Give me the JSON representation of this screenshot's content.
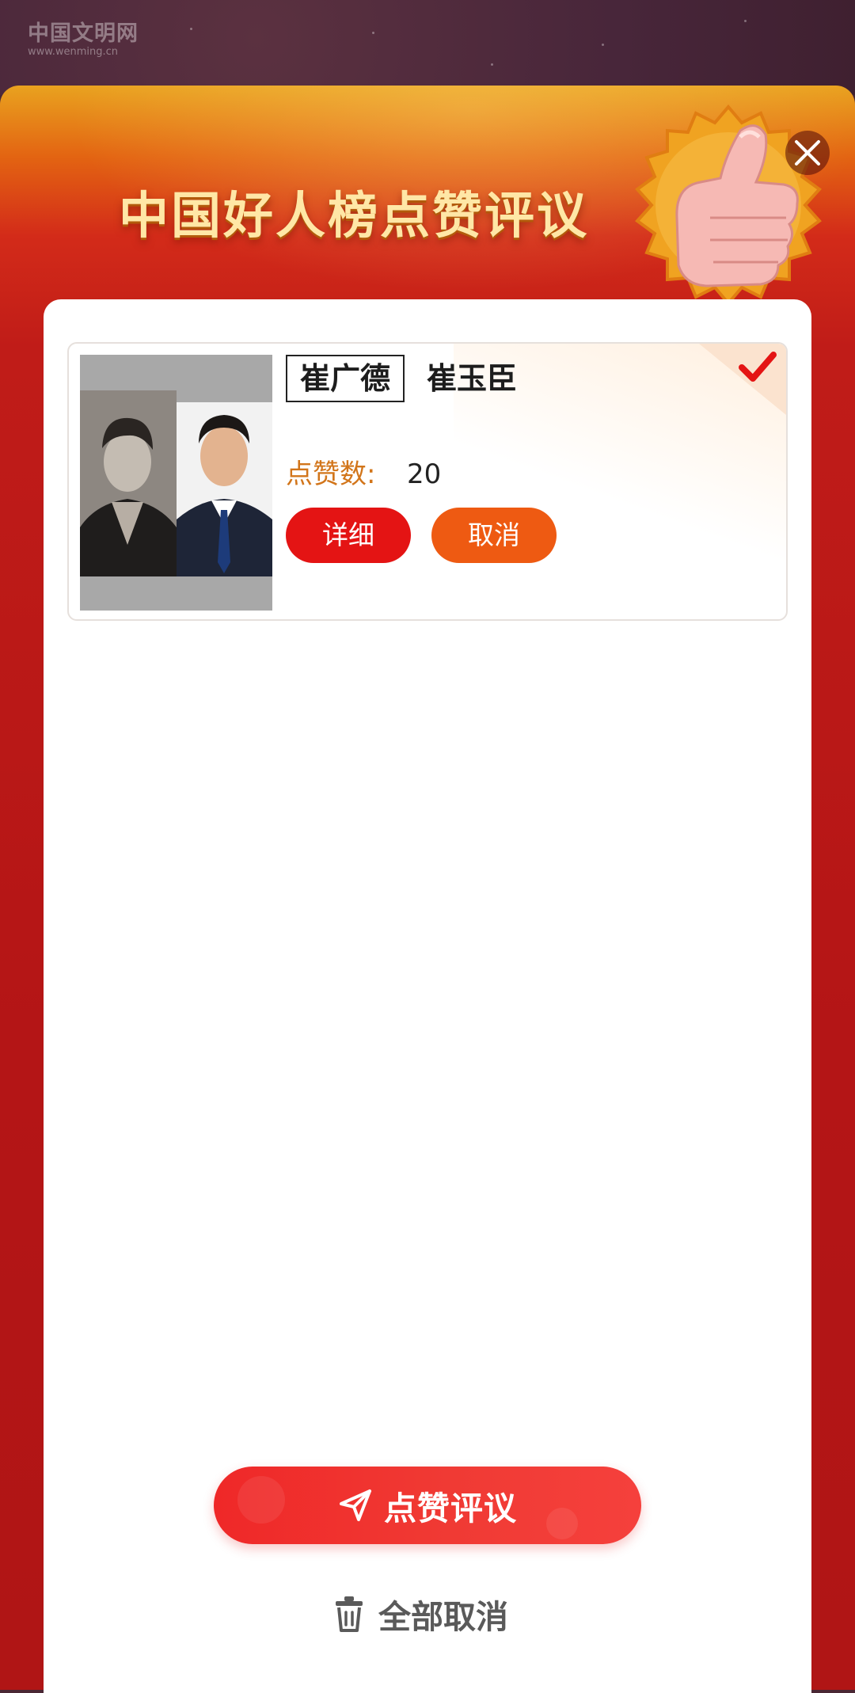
{
  "watermark": {
    "name": "中国文明网",
    "url": "www.wenming.cn"
  },
  "modal": {
    "title": "中国好人榜点赞评议"
  },
  "selected_item": {
    "names": [
      "崔广德",
      "崔玉臣"
    ],
    "likes_label": "点赞数:",
    "likes_value": "20",
    "detail_label": "详细",
    "cancel_label": "取消",
    "selected": true
  },
  "actions": {
    "submit_label": "点赞评议",
    "clear_all_label": "全部取消"
  },
  "colors": {
    "primary_red": "#e41414",
    "cancel_orange": "#ee5a12",
    "likes_label": "#d2751a",
    "title_gold": "#ffe7a6"
  },
  "icons": [
    "close-icon",
    "thumbs-up-icon",
    "checkmark-icon",
    "send-icon",
    "trash-icon"
  ]
}
